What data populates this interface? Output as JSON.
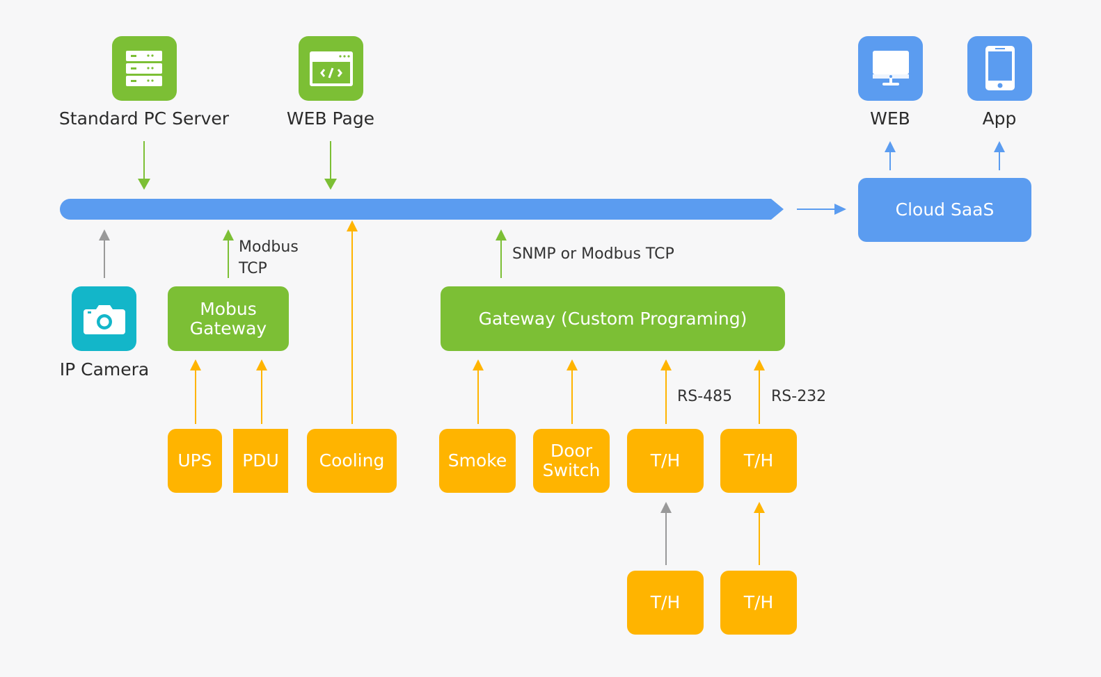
{
  "top_nodes": {
    "server": {
      "label": "Standard PC Server",
      "icon": "server-icon"
    },
    "web_page": {
      "label": "WEB Page",
      "icon": "code-window-icon"
    },
    "web": {
      "label": "WEB",
      "icon": "monitor-icon"
    },
    "app": {
      "label": "App",
      "icon": "smartphone-icon"
    }
  },
  "cloud": {
    "label": "Cloud SaaS"
  },
  "camera": {
    "label": "IP Camera",
    "icon": "camera-icon"
  },
  "mobus_gateway": {
    "label_line1": "Mobus",
    "label_line2": "Gateway"
  },
  "custom_gateway": {
    "label": "Gateway (Custom Programing)"
  },
  "annotations": {
    "modbus_line1": "Modbus",
    "modbus_line2": "TCP",
    "snmp": "SNMP or Modbus TCP",
    "rs485": "RS-485",
    "rs232": "RS-232"
  },
  "devices": {
    "ups": "UPS",
    "pdu": "PDU",
    "cooling": "Cooling",
    "smoke": "Smoke",
    "door_line1": "Door",
    "door_line2": "Switch",
    "th1": "T/H",
    "th2": "T/H",
    "th3": "T/H",
    "th4": "T/H"
  },
  "colors": {
    "green": "#7cbf35",
    "blue": "#5b9cf0",
    "orange": "#ffb400",
    "teal": "#13b6c9",
    "gray_arrow": "#999999"
  }
}
